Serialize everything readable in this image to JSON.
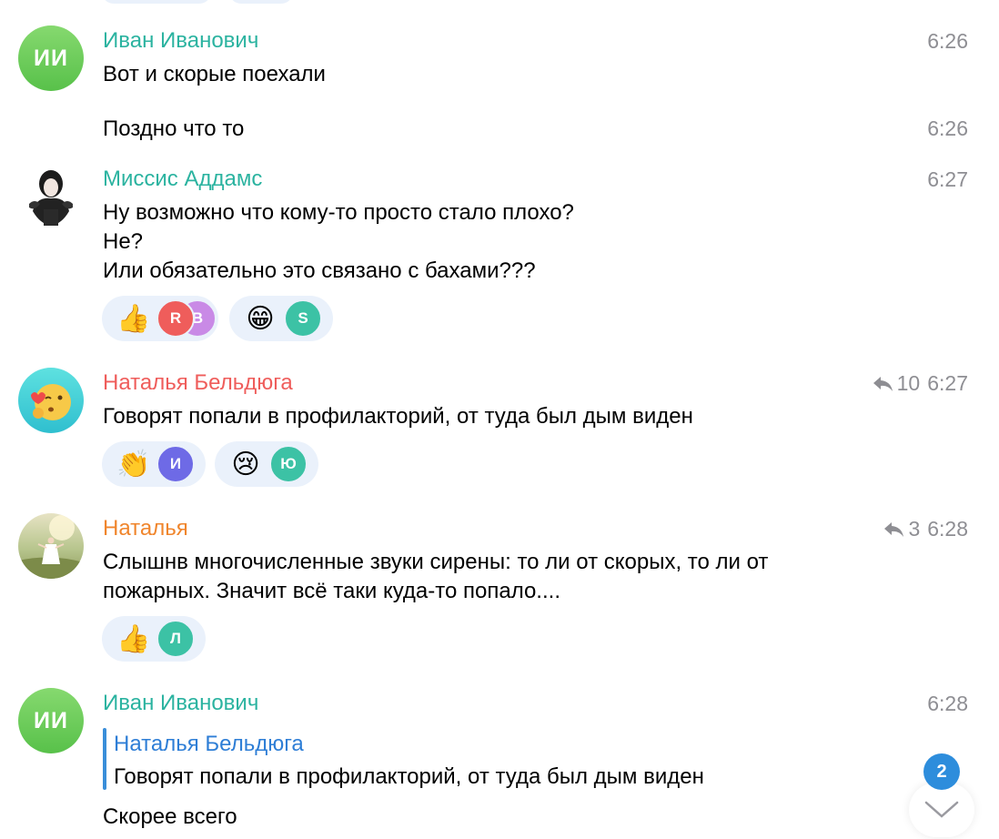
{
  "colors": {
    "green_name": "#2bb3a0",
    "red_name": "#ef5d5b",
    "orange_name": "#f0852c",
    "quote_blue": "#2e7ed6",
    "time_gray": "#8e8e93",
    "reaction_bg": "#eaf1fb",
    "badge_blue": "#2d8ddc"
  },
  "messages": [
    {
      "author": "Иван Иванович",
      "avatar_initials": "ИИ",
      "time": "6:26",
      "text": "Вот и скорые поехали"
    },
    {
      "time": "6:26",
      "text": "Поздно что то"
    },
    {
      "author": "Миссис Аддамс",
      "avatar_icon": "wednesday-addams-avatar",
      "time": "6:27",
      "lines": [
        "Ну возможно что кому-то просто стало плохо?",
        "Не?",
        "Или обязательно это связано с бахами???"
      ],
      "reactions": [
        {
          "emoji": "👍",
          "icon": "thumbs-up-icon",
          "users": [
            "R",
            "B"
          ]
        },
        {
          "emoji": "😁",
          "icon": "grin-icon",
          "users": [
            "S"
          ]
        }
      ]
    },
    {
      "author": "Наталья Бельдюга",
      "avatar_icon": "blowing-kiss-emoji-avatar",
      "replies": "10",
      "time": "6:27",
      "text": "Говорят попали в профилакторий, от туда был дым виден",
      "reactions": [
        {
          "emoji": "👏",
          "icon": "clapping-icon",
          "users": [
            "И"
          ]
        },
        {
          "emoji": "😢",
          "icon": "crying-icon",
          "users": [
            "Ю"
          ]
        }
      ]
    },
    {
      "author": "Наталья",
      "avatar_icon": "girl-in-field-photo-avatar",
      "replies": "3",
      "time": "6:28",
      "lines": [
        "Слышнв многочисленные звуки сирены: то ли от скорых, то ли от",
        "пожарных. Значит всё таки куда-то попало...."
      ],
      "reactions": [
        {
          "emoji": "👍",
          "icon": "thumbs-up-icon",
          "users": [
            "Л"
          ]
        }
      ]
    },
    {
      "author": "Иван Иванович",
      "avatar_initials": "ИИ",
      "time": "6:28",
      "quote_author": "Наталья Бельдюга",
      "quote_text": "Говорят попали в профилакторий, от туда был дым виден",
      "text": "Скорее всего"
    }
  ],
  "unread_badge": "2"
}
